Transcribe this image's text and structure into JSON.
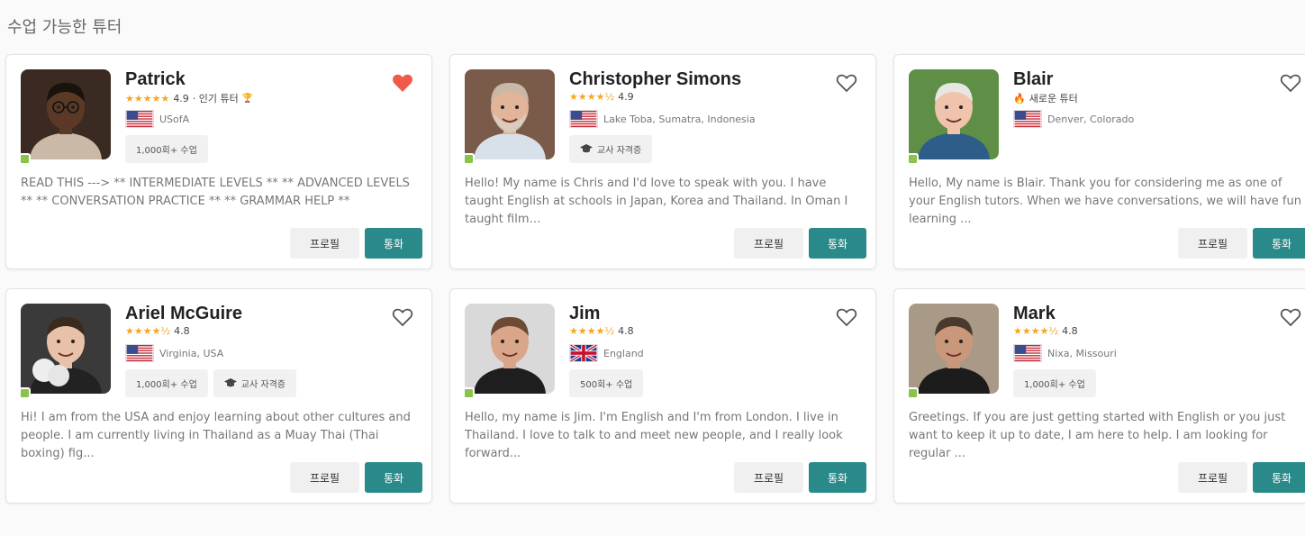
{
  "section_title": "수업 가능한 튜터",
  "buttons": {
    "profile": "프로필",
    "call": "통화"
  },
  "tutors": [
    {
      "name": "Patrick",
      "stars": "★★★★★",
      "rating": "4.9",
      "extra": "· 인기 튜터",
      "extra_icon": "trophy-icon",
      "location": "USofA",
      "flag": "us",
      "favorited": true,
      "badges": [
        {
          "label": "1,000회+ 수업",
          "icon": ""
        }
      ],
      "description": "READ THIS ---> ** INTERMEDIATE LEVELS ** ** ADVANCED LEVELS ** ** CONVERSATION PRACTICE ** ** GRAMMAR HELP **"
    },
    {
      "name": "Christopher Simons",
      "stars": "★★★★½",
      "rating": "4.9",
      "extra": "",
      "location": "Lake Toba, Sumatra, Indonesia",
      "flag": "us",
      "favorited": false,
      "badges": [
        {
          "label": "교사 자격증",
          "icon": "graduation-cap-icon"
        }
      ],
      "description": "Hello! My name is Chris and I'd love to speak with you. I have taught English at schools in Japan, Korea and Thailand. In Oman I taught film…"
    },
    {
      "name": "Blair",
      "stars": "",
      "rating": "",
      "extra": "새로운 튜터",
      "extra_icon": "fire-icon",
      "location": "Denver, Colorado",
      "flag": "us",
      "favorited": false,
      "badges": [],
      "description": "Hello, My name is Blair. Thank you for considering me as one of your English tutors. When we have conversations, we will have fun learning ..."
    },
    {
      "name": "Ariel McGuire",
      "stars": "★★★★½",
      "rating": "4.8",
      "extra": "",
      "location": "Virginia, USA",
      "flag": "us",
      "favorited": false,
      "badges": [
        {
          "label": "1,000회+ 수업",
          "icon": ""
        },
        {
          "label": "교사 자격증",
          "icon": "graduation-cap-icon"
        }
      ],
      "description": "Hi! I am from the USA and enjoy learning about other cultures and people. I am currently living in Thailand as a Muay Thai (Thai boxing) fig..."
    },
    {
      "name": "Jim",
      "stars": "★★★★½",
      "rating": "4.8",
      "extra": "",
      "location": "England",
      "flag": "uk",
      "favorited": false,
      "badges": [
        {
          "label": "500회+ 수업",
          "icon": ""
        }
      ],
      "description": "Hello, my name is Jim. I'm English and I'm from London. I live in Thailand. I love to talk to and meet new people, and I really look forward..."
    },
    {
      "name": "Mark",
      "stars": "★★★★½",
      "rating": "4.8",
      "extra": "",
      "location": "Nixa, Missouri",
      "flag": "us",
      "favorited": false,
      "badges": [
        {
          "label": "1,000회+ 수업",
          "icon": ""
        }
      ],
      "description": "Greetings. If you are just getting started with English or you just want to keep it up to date, I am here to help. I am looking for regular ..."
    }
  ]
}
